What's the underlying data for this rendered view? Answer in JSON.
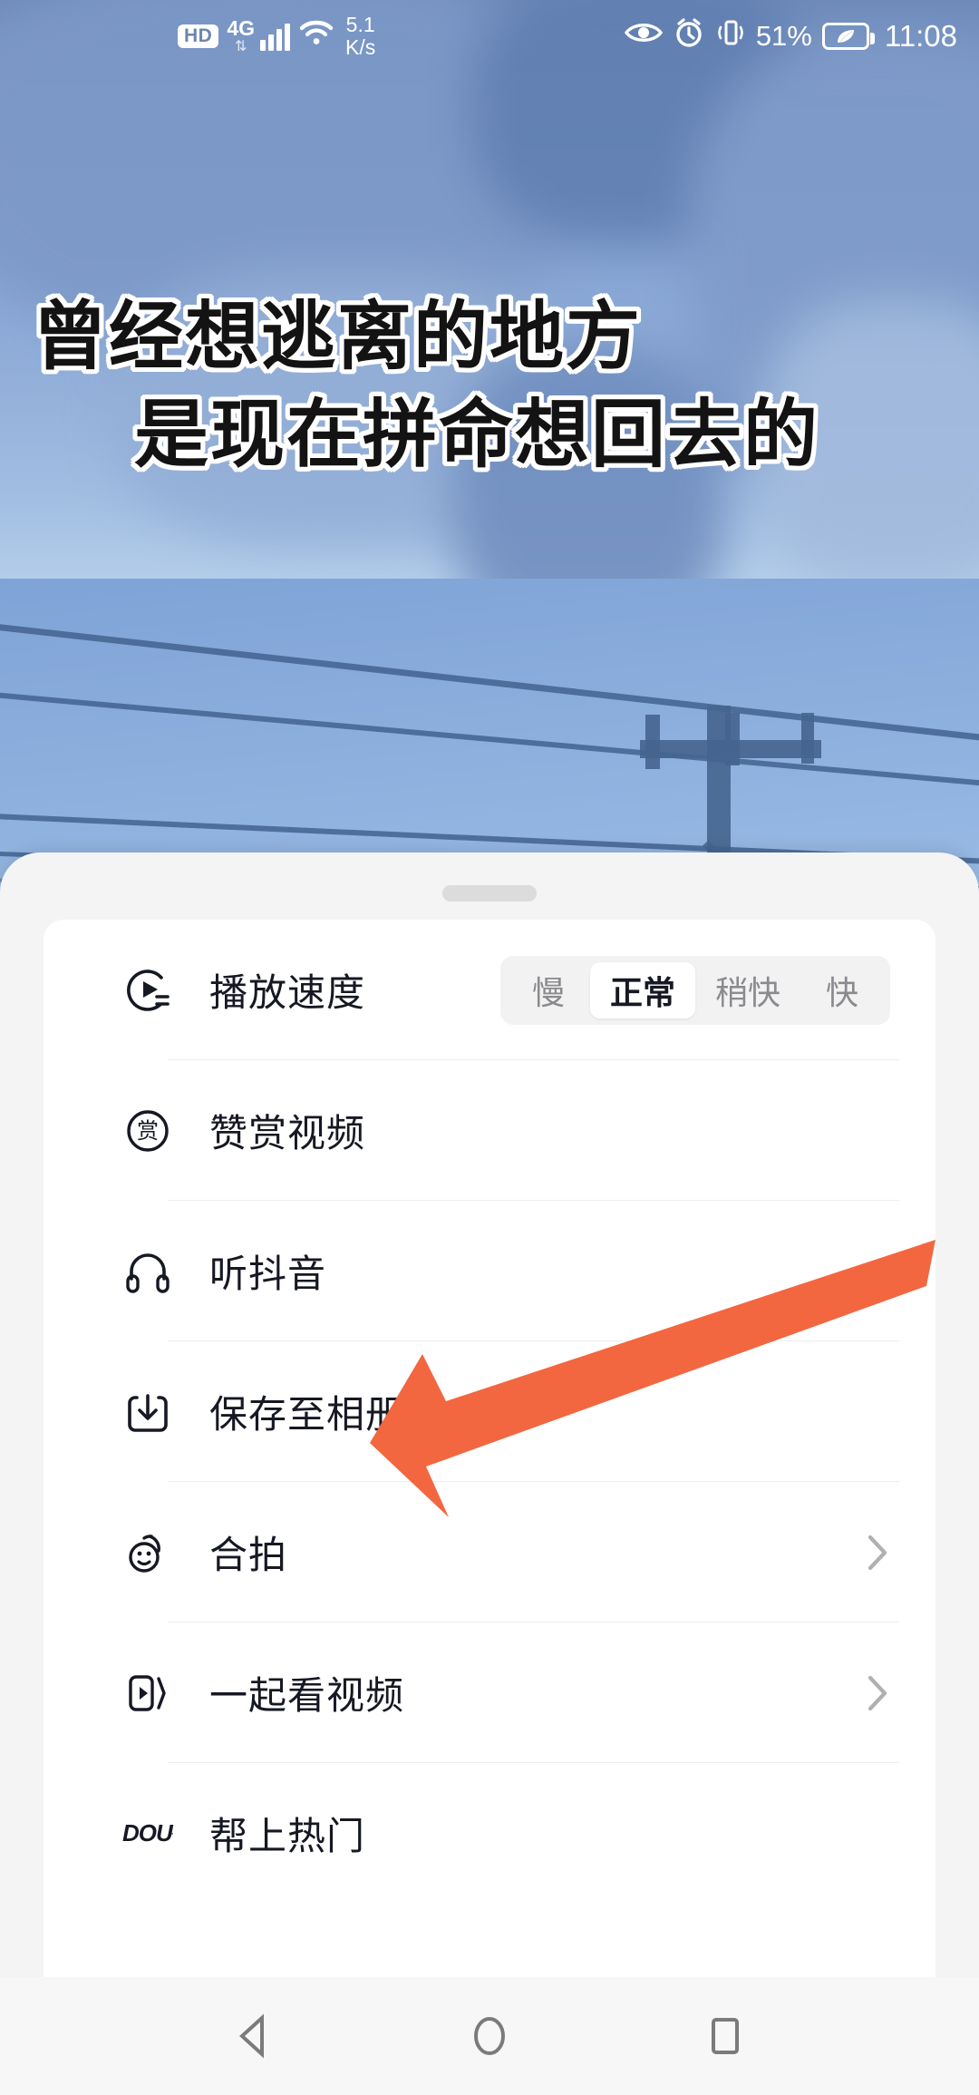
{
  "status_bar": {
    "hd_label": "HD",
    "network_type": "4G",
    "network_arrows": "⇅",
    "wifi_icon": "wifi-icon",
    "net_speed_value": "5.1",
    "net_speed_unit": "K/s",
    "eye_icon": "eye-comfort-icon",
    "alarm_icon": "alarm-clock-icon",
    "vibrate_icon": "vibrate-mode-icon",
    "battery_percent": "51%",
    "battery_saver_icon": "leaf-power-saving-icon",
    "clock": "11:08"
  },
  "video": {
    "subtitle_line_1": "曾经想逃离的地方",
    "subtitle_line_2": "是现在拼命想回去的"
  },
  "sheet": {
    "handle": "drag-handle",
    "speed_row": {
      "icon": "playback-speed-icon",
      "label": "播放速度",
      "options": [
        {
          "label": "慢",
          "selected": false
        },
        {
          "label": "正常",
          "selected": true
        },
        {
          "label": "稍快",
          "selected": false
        },
        {
          "label": "快",
          "selected": false
        }
      ]
    },
    "items": [
      {
        "icon": "reward-circle-icon",
        "label": "赞赏视频",
        "chevron": false
      },
      {
        "icon": "headphones-icon",
        "label": "听抖音",
        "chevron": false
      },
      {
        "icon": "download-to-album-icon",
        "label": "保存至相册",
        "chevron": false
      },
      {
        "icon": "duet-face-icon",
        "label": "合拍",
        "chevron": true
      },
      {
        "icon": "watch-together-icon",
        "label": "一起看视频",
        "chevron": true
      },
      {
        "icon": "dou-plus-icon",
        "label": "帮上热门",
        "chevron": false
      }
    ],
    "reward_icon_glyph": "赏",
    "dou_plus_glyph": "DOU"
  },
  "annotation": {
    "arrow_color": "#F26740",
    "points_to": "保存至相册"
  },
  "nav_bar": {
    "back": "back-triangle-icon",
    "home": "home-circle-icon",
    "recents": "recents-square-icon"
  },
  "colors": {
    "sheet_bg": "#f4f4f4",
    "card_bg": "#ffffff",
    "text_primary": "#161823",
    "text_muted": "#8a8a8f",
    "divider": "#ededed",
    "accent_orange": "#F26740",
    "sky_blue": "#9cbde6"
  }
}
